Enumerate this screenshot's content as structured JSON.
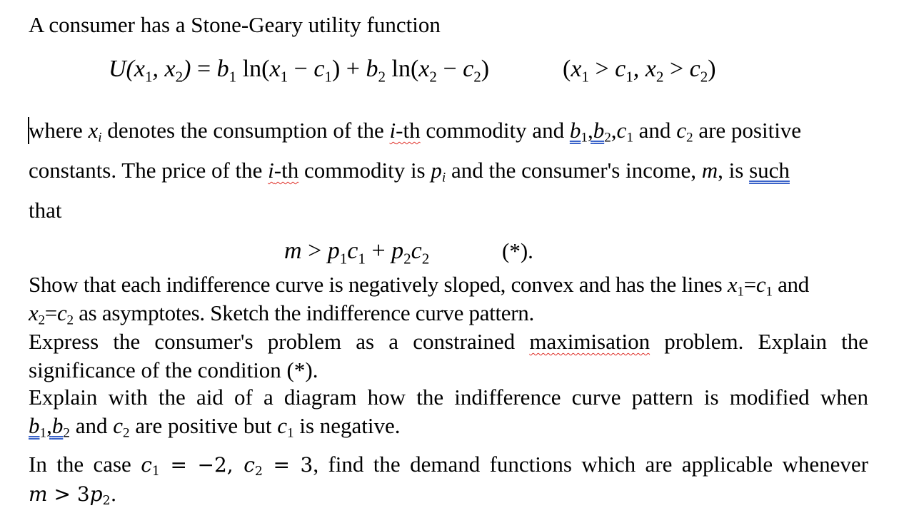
{
  "document": {
    "intro": "A consumer has a Stone-Geary utility function",
    "utility_equation": {
      "lhs": "U(x₁, x₂)",
      "rhs": "b₁ ln(x₁ − c₁) + b₂ ln(x₂ − c₂)",
      "domain": "(x₁ > c₁, x₂ > c₂)"
    },
    "para1": {
      "text_a": "where",
      "var_x": "x",
      "sub_i": "i",
      "text_b": "denotes the consumption of the",
      "ith": "i",
      "ith_suffix": "-th",
      "text_c": "commodity and",
      "b": "b",
      "one": "1",
      "two": "2",
      "comma": ",",
      "c": "c",
      "text_d": "and",
      "text_e": "are positive",
      "line2_a": "constants. The price of the",
      "line2_b": "commodity is",
      "p": "p",
      "line2_c": "and the consumer's income,",
      "m": "m",
      "line2_d": ", is",
      "such": "such",
      "line3": "that"
    },
    "condition": {
      "lhs": "m",
      "gt": ">",
      "rhs_p": "p",
      "rhs_c": "c",
      "plus": "+",
      "label": "(*)."
    },
    "q1": {
      "line1_a": "Show that each indifference curve is negatively sloped, convex and has the lines",
      "line1_b": "and",
      "line2_b": "as asymptotes. Sketch the indifference curve pattern."
    },
    "q2": {
      "line1_a": "Express the consumer's problem as a constrained",
      "line1_word": "maximisation",
      "line1_b": "problem. Explain the",
      "line2": "significance of the condition (*)."
    },
    "q3": {
      "line1": "Explain with the aid of a diagram how the indifference curve pattern is modified when",
      "line2_a": "and",
      "line2_b": "are positive but",
      "line2_c": "is negative."
    },
    "q4": {
      "line1_a": "In the case",
      "c1_value": "−2",
      "c2_value": "3",
      "line1_b": ", find the demand functions which are applicable whenever",
      "line2_cond": "m > 3p",
      "line2_end": "."
    }
  }
}
